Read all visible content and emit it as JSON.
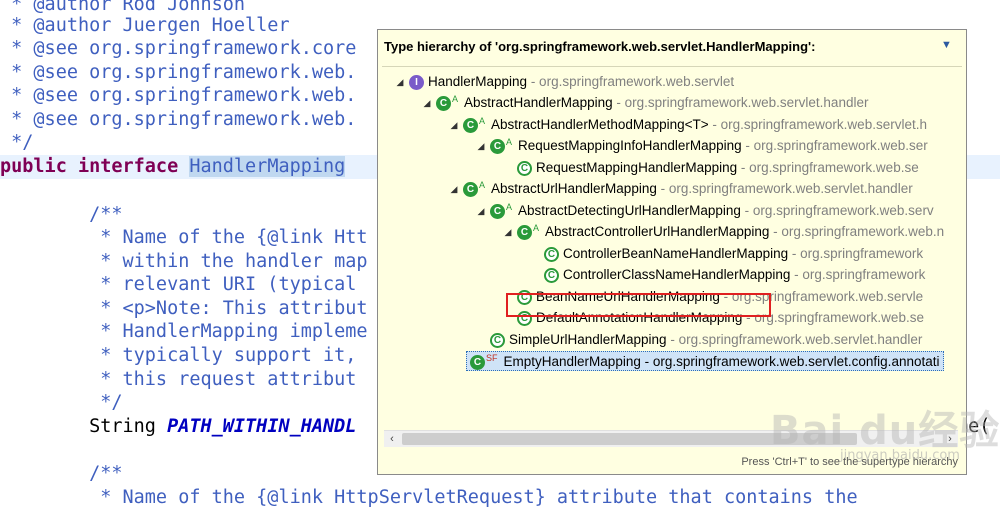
{
  "editor": {
    "lines": {
      "l0": " * @author Rod Johnson",
      "l1": " * @author Juergen Hoeller",
      "l2": " * @see org.springframework.core",
      "l3": " * @see org.springframework.web.",
      "l4": " * @see org.springframework.web.",
      "l5": " * @see org.springframework.web.",
      "l6": " */",
      "l7_kw": "public interface ",
      "l7_sel": "HandlerMapping",
      "l9": "        /**",
      "l10": "         * Name of the {@link Htt",
      "l11": "         * within the handler map",
      "l12": "         * relevant URI (typical",
      "l13": "         * <p>Note: This attribut",
      "l14": "         * HandlerMapping impleme",
      "l15": "         * typically support it,",
      "l16": "         * this request attribut",
      "l17": "         */",
      "l18_pre": "        String ",
      "l18_const": "PATH_WITHIN_HANDL",
      "l18_tail": "me(",
      "l20": "        /**",
      "l21": "         * Name of the {@link HttpServletRequest} attribute that contains the"
    }
  },
  "popup": {
    "title": "Type hierarchy of 'org.springframework.web.servlet.HandlerMapping':",
    "menu_icon": "chevron-down-icon",
    "footer": "Press 'Ctrl+T' to see the supertype hierarchy",
    "tree": [
      {
        "name": "HandlerMapping",
        "pkg": " - org.springframework.web.servlet",
        "icon": "interface-icon",
        "expanded": true
      },
      {
        "name": "AbstractHandlerMapping",
        "pkg": " - org.springframework.web.servlet.handler",
        "icon": "abstract-class-icon",
        "sup": "A",
        "expanded": true
      },
      {
        "name": "AbstractHandlerMethodMapping<T>",
        "pkg": " - org.springframework.web.servlet.h",
        "icon": "abstract-class-icon",
        "sup": "A",
        "expanded": true
      },
      {
        "name": "RequestMappingInfoHandlerMapping",
        "pkg": " - org.springframework.web.ser",
        "icon": "abstract-class-icon",
        "sup": "A",
        "expanded": true
      },
      {
        "name": "RequestMappingHandlerMapping",
        "pkg": " - org.springframework.web.se",
        "icon": "class-icon"
      },
      {
        "name": "AbstractUrlHandlerMapping",
        "pkg": " - org.springframework.web.servlet.handler",
        "icon": "abstract-class-icon",
        "sup": "A",
        "expanded": true
      },
      {
        "name": "AbstractDetectingUrlHandlerMapping",
        "pkg": " - org.springframework.web.serv",
        "icon": "abstract-class-icon",
        "sup": "A",
        "expanded": true
      },
      {
        "name": "AbstractControllerUrlHandlerMapping",
        "pkg": " - org.springframework.web.n",
        "icon": "abstract-class-icon",
        "sup": "A",
        "expanded": true
      },
      {
        "name": "ControllerBeanNameHandlerMapping",
        "pkg": " - org.springframework",
        "icon": "class-icon"
      },
      {
        "name": "ControllerClassNameHandlerMapping",
        "pkg": " - org.springframework",
        "icon": "class-icon"
      },
      {
        "name": "BeanNameUrlHandlerMapping",
        "pkg": " - org.springframework.web.servle",
        "icon": "class-icon"
      },
      {
        "name": "DefaultAnnotationHandlerMapping",
        "pkg": " - org.springframework.web.se",
        "icon": "class-icon"
      },
      {
        "name": "SimpleUrlHandlerMapping",
        "pkg": " - org.springframework.web.servlet.handler",
        "icon": "class-icon"
      },
      {
        "name": "EmptyHandlerMapping",
        "pkg": " - org.springframework.web.servlet.config.annotati",
        "icon": "static-final-class-icon",
        "sup": "SF"
      }
    ]
  },
  "watermark": {
    "main": "Bai du经验",
    "sub": "jingyan.baidu.com"
  }
}
